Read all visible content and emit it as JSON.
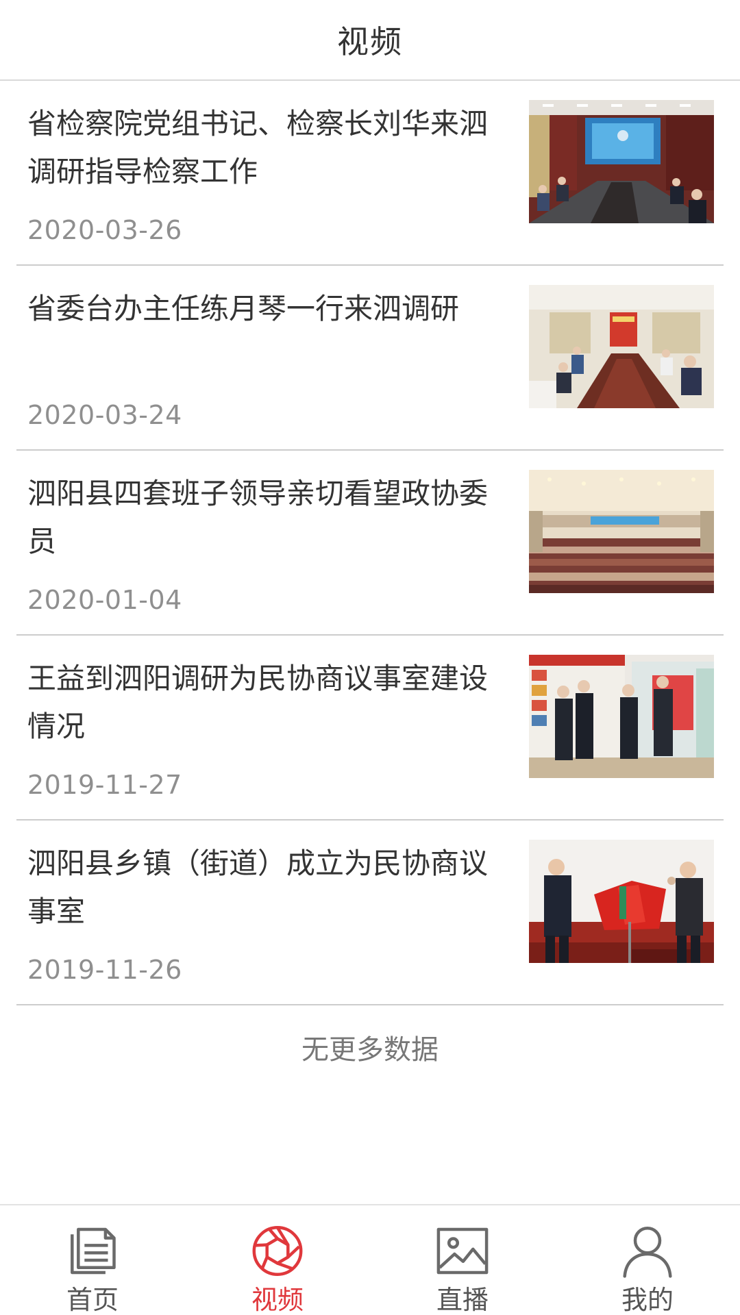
{
  "header": {
    "title": "视频"
  },
  "articles": [
    {
      "title": "省检察院党组书记、检察长刘华来泗调研指导检察工作",
      "date": "2020-03-26"
    },
    {
      "title": "省委台办主任练月琴一行来泗调研",
      "date": "2020-03-24"
    },
    {
      "title": "泗阳县四套班子领导亲切看望政协委员",
      "date": "2020-01-04"
    },
    {
      "title": "王益到泗阳调研为民协商议事室建设情况",
      "date": "2019-11-27"
    },
    {
      "title": "泗阳县乡镇（街道）成立为民协商议事室",
      "date": "2019-11-26"
    }
  ],
  "footer_text": "无更多数据",
  "tabbar": {
    "tabs": [
      {
        "label": "首页",
        "icon": "document-icon"
      },
      {
        "label": "视频",
        "icon": "aperture-icon"
      },
      {
        "label": "直播",
        "icon": "image-icon"
      },
      {
        "label": "我的",
        "icon": "user-icon"
      }
    ],
    "active_index": 1
  },
  "colors": {
    "accent": "#e0383c",
    "text": "#333333",
    "muted": "#8f8f8f",
    "divider": "#cccccc"
  }
}
